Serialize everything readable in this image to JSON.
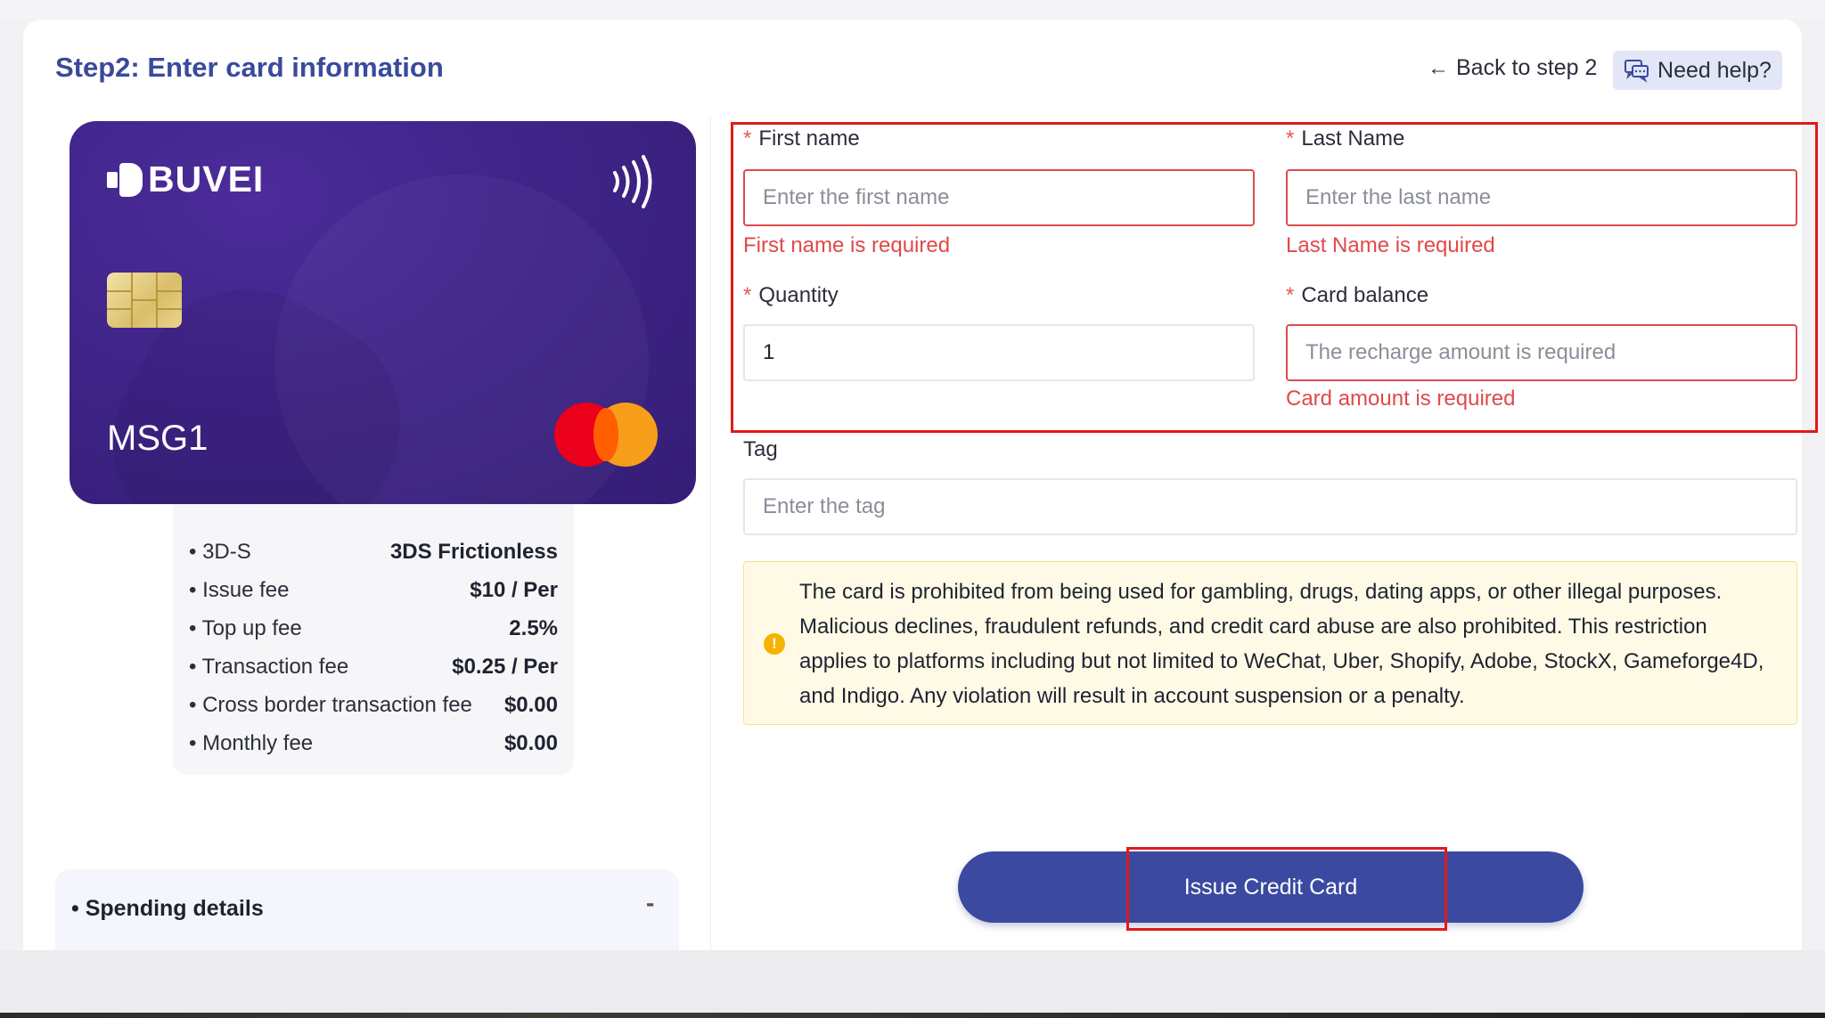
{
  "header": {
    "title": "Step2: Enter card information",
    "back_label": "Back to step 2",
    "help_label": "Need help?"
  },
  "card": {
    "brand": "BUVEI",
    "name": "MSG1",
    "network": "mastercard"
  },
  "fees": [
    {
      "label": "3D-S",
      "value": "3DS Frictionless"
    },
    {
      "label": "Issue fee",
      "value": "$10 / Per"
    },
    {
      "label": "Top up fee",
      "value": "2.5%"
    },
    {
      "label": "Transaction fee",
      "value": "$0.25 / Per"
    },
    {
      "label": "Cross border transaction fee",
      "value": "$0.00"
    },
    {
      "label": "Monthly fee",
      "value": "$0.00"
    }
  ],
  "spending": {
    "title": "Spending details",
    "toggle": "-"
  },
  "form": {
    "required_mark": "*",
    "first_name": {
      "label": "First name",
      "placeholder": "Enter the first name",
      "value": "",
      "error": "First name is required"
    },
    "last_name": {
      "label": "Last Name",
      "placeholder": "Enter the last name",
      "value": "",
      "error": "Last Name is required"
    },
    "quantity": {
      "label": "Quantity",
      "value": "1"
    },
    "card_balance": {
      "label": "Card balance",
      "placeholder": "The recharge amount is required",
      "value": "",
      "error": "Card amount is required"
    },
    "tag": {
      "label": "Tag",
      "placeholder": "Enter the tag",
      "value": ""
    }
  },
  "warning": {
    "icon": "!",
    "text": "The card is prohibited from being used for gambling, drugs, dating apps, or other illegal purposes. Malicious declines, fraudulent refunds, and credit card abuse are also prohibited. This restriction applies to platforms including but not limited to WeChat, Uber, Shopify, Adobe, StockX, Gameforge4D, and Indigo. Any violation will result in account suspension or a penalty."
  },
  "submit": {
    "label": "Issue Credit Card"
  },
  "colors": {
    "accent": "#3b4aa0",
    "title": "#3a4a9c",
    "error": "#e0494a",
    "annotation": "#e01a1a",
    "card": "#3f2488",
    "warning_bg": "#fffae6"
  }
}
